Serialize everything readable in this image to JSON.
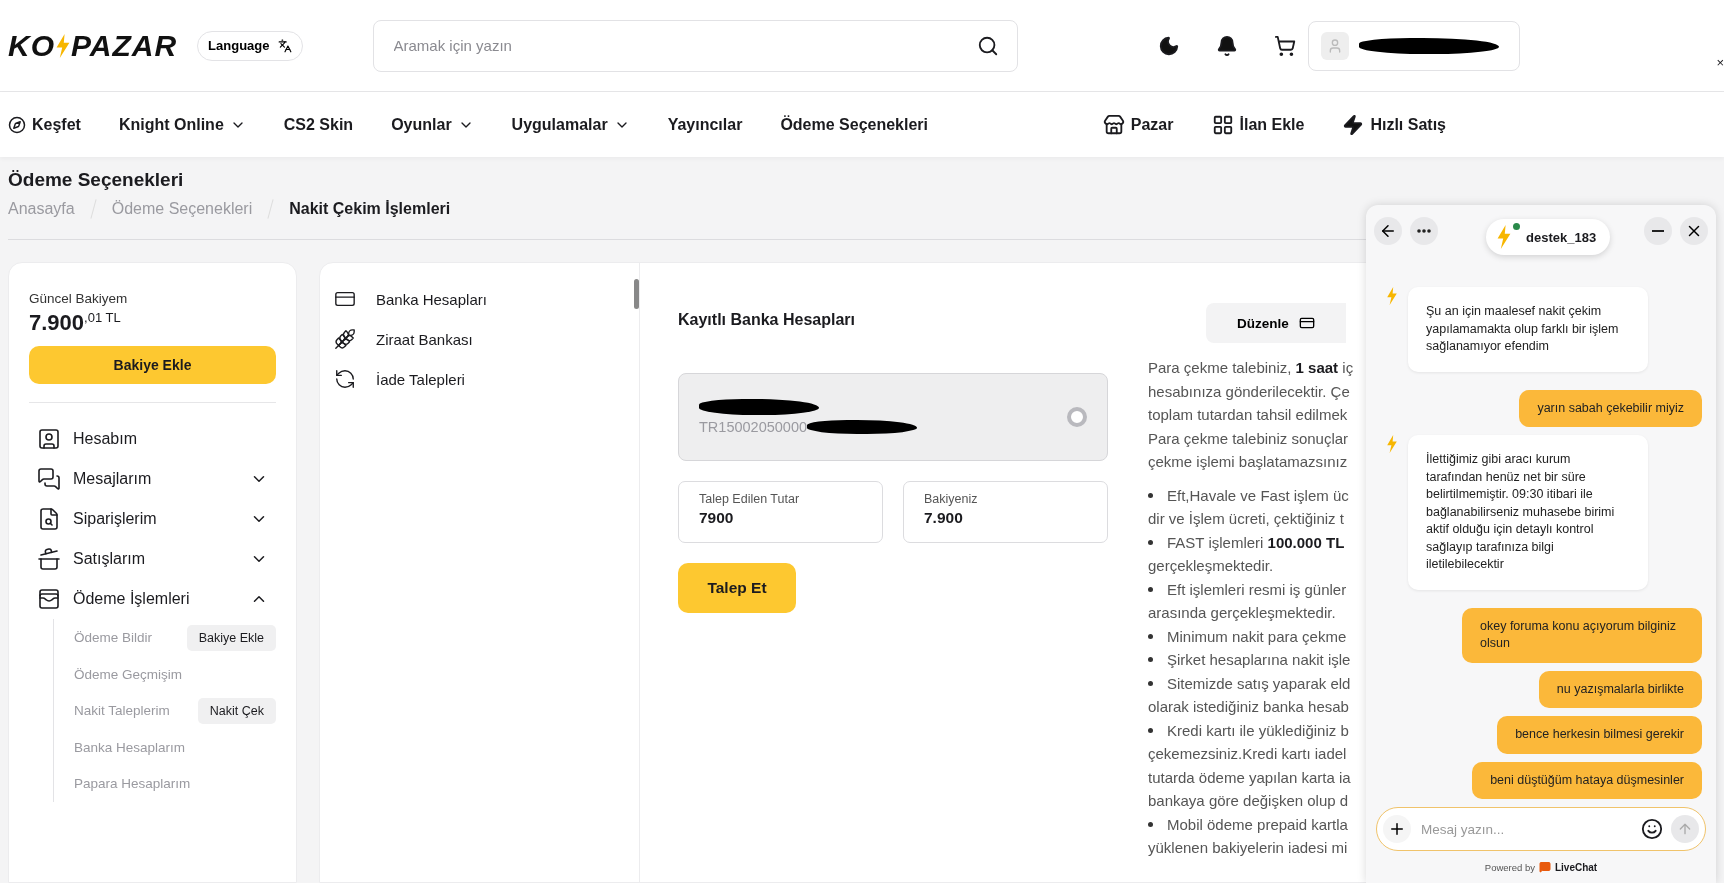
{
  "header": {
    "logo": {
      "left": "KO",
      "right": "PAZAR"
    },
    "language": "Language",
    "search": {
      "placeholder": "Aramak için yazın"
    },
    "edge_mark": "×"
  },
  "nav": {
    "items": [
      {
        "label": "Keşfet",
        "dropdown": false
      },
      {
        "label": "Knight Online",
        "dropdown": true
      },
      {
        "label": "CS2 Skin",
        "dropdown": false
      },
      {
        "label": "Oyunlar",
        "dropdown": true
      },
      {
        "label": "Uygulamalar",
        "dropdown": true
      },
      {
        "label": "Yayıncılar",
        "dropdown": false
      },
      {
        "label": "Ödeme Seçenekleri",
        "dropdown": false
      }
    ],
    "actions": [
      {
        "label": "Pazar"
      },
      {
        "label": "İlan Ekle"
      },
      {
        "label": "Hızlı Satış"
      }
    ]
  },
  "page": {
    "title": "Ödeme Seçenekleri",
    "breadcrumb": [
      {
        "label": "Anasayfa",
        "selected": false
      },
      {
        "label": "Ödeme Seçenekleri",
        "selected": false
      },
      {
        "label": "Nakit Çekim İşlemleri",
        "selected": true
      }
    ]
  },
  "balance": {
    "label": "Güncel Bakiyem",
    "whole": "7.900",
    "fraction": ",01 TL",
    "button": "Bakiye Ekle"
  },
  "menu": [
    {
      "label": "Hesabım"
    },
    {
      "label": "Mesajlarım",
      "expanded": false
    },
    {
      "label": "Siparişlerim",
      "expanded": false
    },
    {
      "label": "Satışlarım",
      "expanded": false
    },
    {
      "label": "Ödeme İşlemleri",
      "expanded": true,
      "children": [
        {
          "label": "Ödeme Bildir",
          "action": "Bakiye Ekle"
        },
        {
          "label": "Ödeme Geçmişim"
        },
        {
          "label": "Nakit Taleplerim",
          "action": "Nakit Çek"
        },
        {
          "label": "Banka Hesaplarım"
        },
        {
          "label": "Papara Hesaplarım"
        }
      ]
    }
  ],
  "submenu": [
    {
      "label": "Banka Hesapları"
    },
    {
      "label": "Ziraat Bankası"
    },
    {
      "label": "İade Talepleri"
    }
  ],
  "accounts": {
    "title": "Kayıtlı Banka Hesapları",
    "edit_button": "Düzenle",
    "card": {
      "iban": "TR15002050000",
      "selected": false
    },
    "fields": [
      {
        "label": "Talep Edilen Tutar",
        "value": "7900"
      },
      {
        "label": "Bakiyeniz",
        "value": "7.900"
      }
    ],
    "submit": "Talep Et"
  },
  "info": {
    "paragraph": [
      "Para çekme talebiniz, **1 saat** iç",
      "hesabınıza gönderilecektir. Çe",
      "toplam tutardan tahsil edilmek",
      "Para çekme talebiniz sonuçlar",
      "çekme işlemi başlatamazsınız"
    ],
    "bullets": [
      {
        "lines": [
          "Eft,Havale ve Fast işlem üc",
          "dir ve İşlem ücreti, çektiğiniz t"
        ]
      },
      {
        "lines": [
          "FAST işlemleri **100.000 TL**",
          "gerçekleşmektedir."
        ]
      },
      {
        "lines": [
          "Eft işlemleri resmi iş günler",
          "arasında gerçekleşmektedir."
        ]
      },
      {
        "lines": [
          "Minimum nakit para çekme"
        ]
      },
      {
        "lines": [
          "Şirket hesaplarına nakit işle"
        ]
      },
      {
        "lines": [
          "Sitemizde satış yaparak eld",
          "olarak istediğiniz banka hesab"
        ]
      },
      {
        "lines": [
          "Kredi kartı ile yüklediğiniz b",
          "çekemezsiniz.Kredi kartı iadel",
          "tutarda ödeme yapılan karta ia",
          "bankaya göre değişken olup d"
        ]
      },
      {
        "lines": [
          "Mobil ödeme prepaid kartla",
          "yüklenen bakiyelerin iadesi mi"
        ]
      }
    ]
  },
  "chat": {
    "agent": "destek_183",
    "online": true,
    "messages": [
      {
        "kind": "agent",
        "text": "Şu an için maalesef nakit çekim yapılamamakta olup farklı bir işlem sağlanamıyor efendim"
      },
      {
        "kind": "user",
        "text": "yarın sabah çekebilir miyiz"
      },
      {
        "kind": "agent",
        "text": "İlettiğimiz gibi aracı kurum tarafından henüz net bir süre belirtilmemiştir. 09:30 itibari ile bağlanabilirseniz muhasebe birimi aktif olduğu için detaylı kontrol sağlayıp tarafınıza bilgi iletilebilecektir"
      },
      {
        "kind": "user",
        "text": "okey foruma konu açıyorum bilginiz olsun"
      },
      {
        "kind": "user",
        "text": "nu yazışmalarla birlikte"
      },
      {
        "kind": "user",
        "text": "bence herkesin bilmesi gerekir"
      },
      {
        "kind": "user",
        "text": "beni düştüğüm hataya düşmesinler"
      }
    ],
    "input": {
      "placeholder": "Mesaj yazın..."
    },
    "powered_by": "Powered by",
    "brand": "LiveChat"
  }
}
